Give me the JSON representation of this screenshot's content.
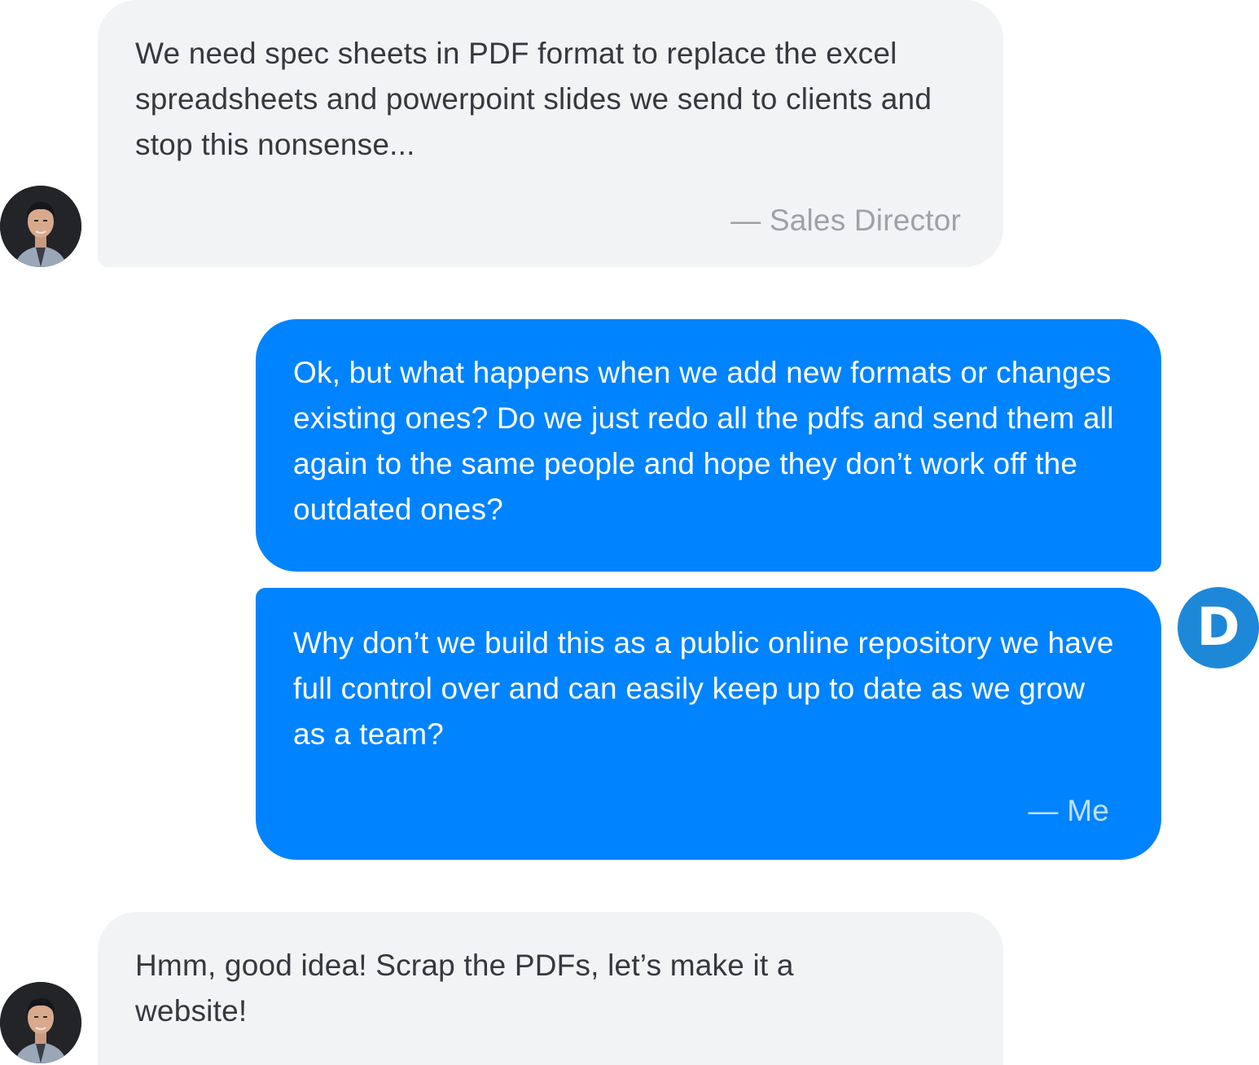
{
  "conversation": {
    "messages": [
      {
        "sender": "Sales Director",
        "text": "We need spec sheets in PDF format to replace the excel spreadsheets and powerpoint slides we send to clients and stop this nonsense...",
        "signature": "— Sales Director"
      },
      {
        "sender": "Me",
        "text": "Ok, but what happens when we add new formats or changes existing ones? Do we just redo all the pdfs and send them all again to the same people and hope they don’t work off the outdated ones?"
      },
      {
        "sender": "Me",
        "text": "Why don’t we build this as a public online repository we have full control over and can easily keep up to date as we grow as a team?",
        "signature": "— Me"
      },
      {
        "sender": "Sales Director",
        "text": "Hmm, good idea! Scrap the PDFs, let’s make it a website!"
      }
    ],
    "me_avatar_letter": "D"
  },
  "colors": {
    "received_bubble": "#f2f3f5",
    "sent_bubble": "#0083ff",
    "me_avatar": "#1e88d8"
  }
}
